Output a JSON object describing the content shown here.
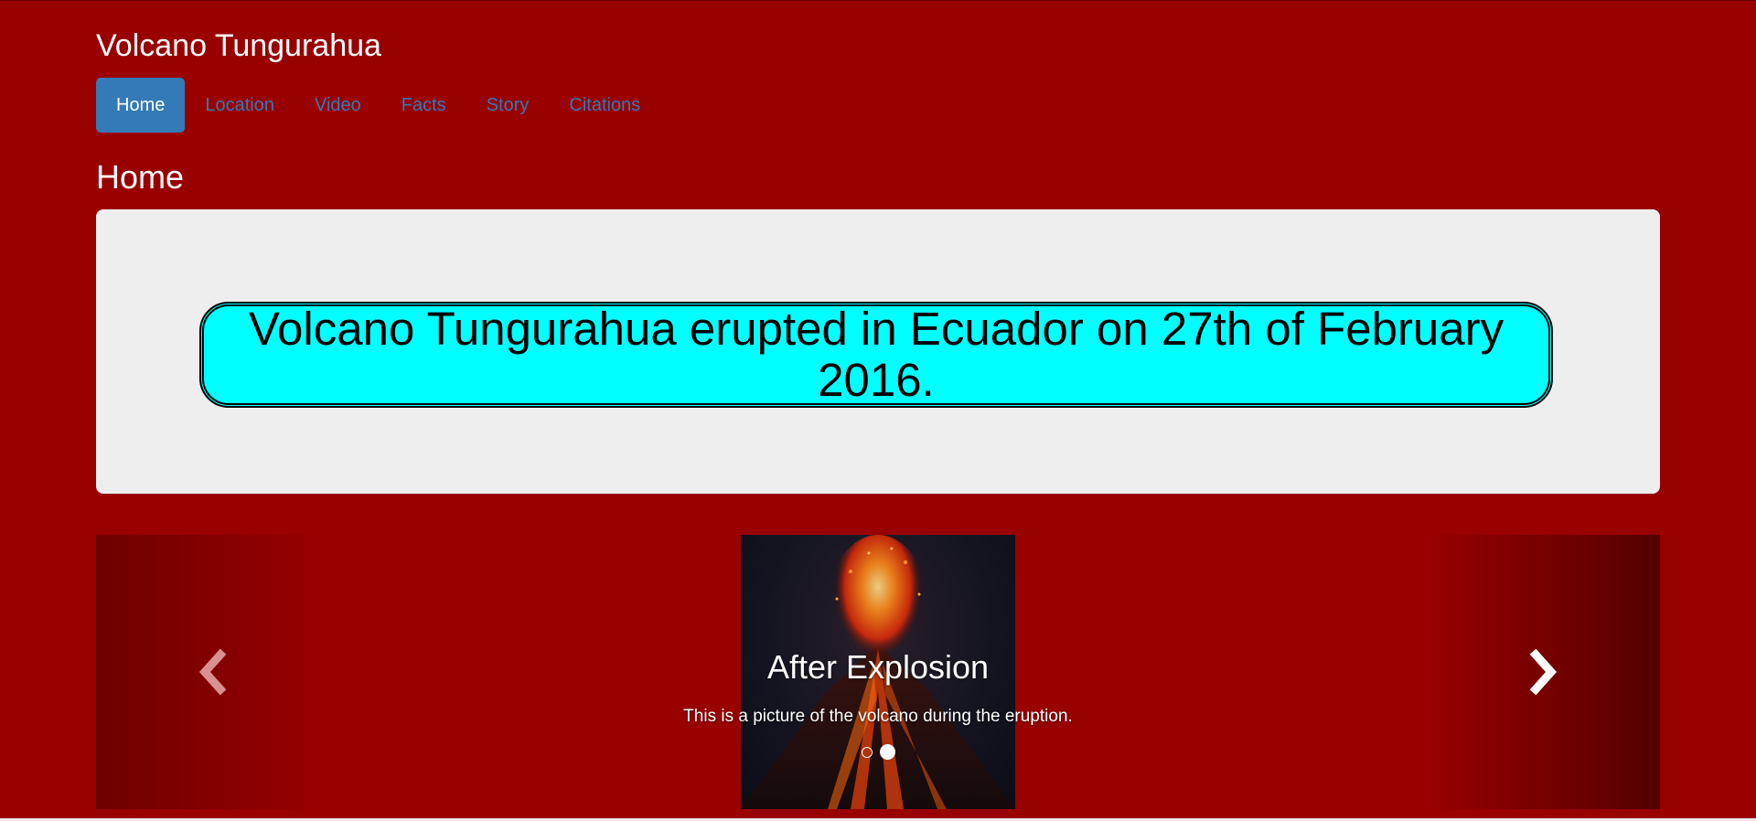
{
  "site": {
    "title": "Volcano Tungurahua"
  },
  "nav": {
    "items": [
      {
        "label": "Home",
        "active": true
      },
      {
        "label": "Location",
        "active": false
      },
      {
        "label": "Video",
        "active": false
      },
      {
        "label": "Facts",
        "active": false
      },
      {
        "label": "Story",
        "active": false
      },
      {
        "label": "Citations",
        "active": false
      }
    ]
  },
  "page": {
    "heading": "Home"
  },
  "jumbotron": {
    "banner_text": "Volcano Tungurahua erupted in Ecuador on 27th of February 2016."
  },
  "carousel": {
    "caption_title": "After Explosion",
    "caption_text": "This is a picture of the volcano during the eruption.",
    "slide_count": 2,
    "active_slide": 2,
    "prev_icon": "chevron-left-icon",
    "next_icon": "chevron-right-icon"
  },
  "colors": {
    "background": "#990000",
    "nav_link": "#337ab7",
    "nav_active_bg": "#337ab7",
    "jumbotron_bg": "#eeeeee",
    "banner_bg": "#00ffff"
  }
}
